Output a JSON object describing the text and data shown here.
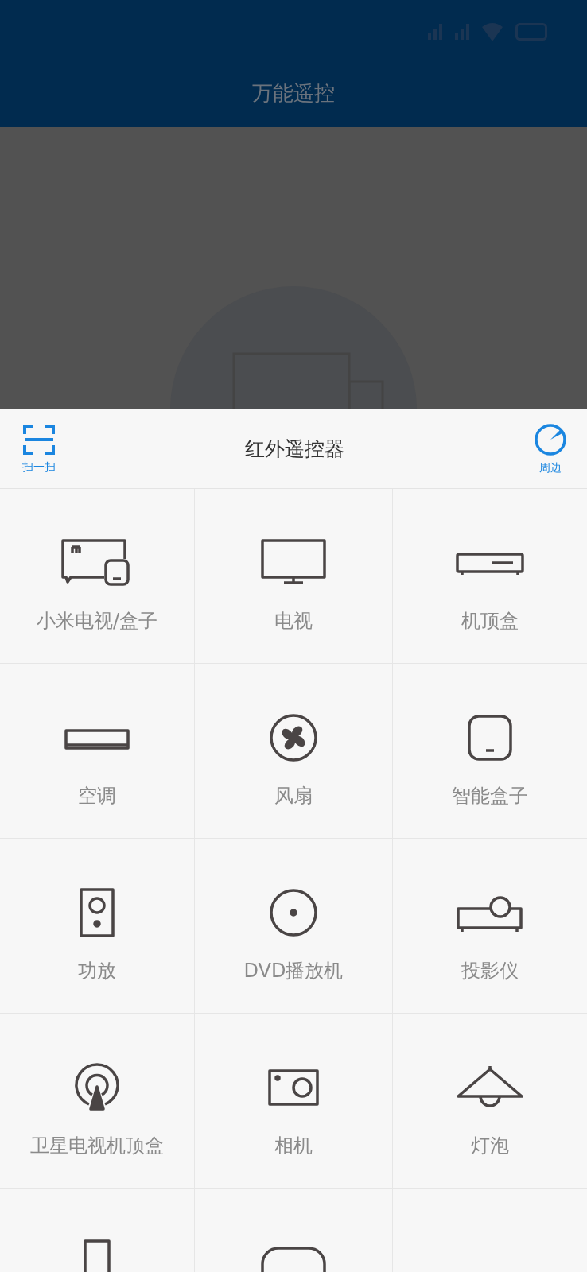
{
  "app_bar": {
    "title": "万能遥控"
  },
  "sheet": {
    "title": "红外遥控器",
    "scan_button": {
      "label": "扫一扫"
    },
    "nearby_button": {
      "label": "周边"
    }
  },
  "devices": [
    {
      "label": "小米电视/盒子",
      "kind": "mitv"
    },
    {
      "label": "电视",
      "kind": "tv"
    },
    {
      "label": "机顶盒",
      "kind": "settopbox"
    },
    {
      "label": "空调",
      "kind": "aircon"
    },
    {
      "label": "风扇",
      "kind": "fan"
    },
    {
      "label": "智能盒子",
      "kind": "smartbox"
    },
    {
      "label": "功放",
      "kind": "amplifier"
    },
    {
      "label": "DVD播放机",
      "kind": "dvd"
    },
    {
      "label": "投影仪",
      "kind": "projector"
    },
    {
      "label": "卫星电视机顶盒",
      "kind": "satellite"
    },
    {
      "label": "相机",
      "kind": "camera"
    },
    {
      "label": "灯泡",
      "kind": "lamp"
    },
    {
      "kind": "tall"
    },
    {
      "kind": "pill"
    }
  ]
}
